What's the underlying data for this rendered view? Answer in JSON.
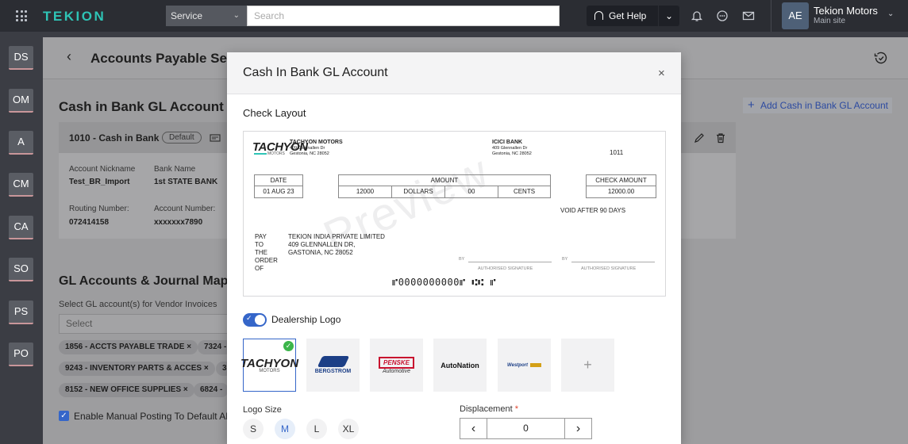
{
  "topbar": {
    "brand": "TEKION",
    "service_select": "Service",
    "search_placeholder": "Search",
    "help_label": "Get Help",
    "account": {
      "initials": "AE",
      "name": "Tekion Motors",
      "site": "Main site"
    }
  },
  "sidebar": {
    "items": [
      "DS",
      "OM",
      "A",
      "CM",
      "CA",
      "SO",
      "PS",
      "PO"
    ]
  },
  "page": {
    "title": "Accounts Payable Setti",
    "section_title": "Cash in Bank GL Account",
    "add_link": "Add Cash in Bank GL Account",
    "card": {
      "title": "1010 - Cash in Bank",
      "badge": "Default",
      "fields": {
        "nickname_label": "Account Nickname",
        "nickname_value": "Test_BR_Import",
        "bank_label": "Bank Name",
        "bank_value": "1st STATE BANK",
        "routing_label": "Routing Number:",
        "routing_value": "072414158",
        "account_label": "Account Number:",
        "account_value": "xxxxxxx7890"
      }
    },
    "gl_title": "GL Accounts & Journal Mapp",
    "gl_subtitle": "Select GL account(s) for Vendor Invoices",
    "gl_select_placeholder": "Select",
    "chips": [
      "1856 - ACCTS PAYABLE TRADE",
      "7324 -",
      "9243 - INVENTORY PARTS & ACCES",
      "3",
      "8152 - NEW OFFICE SUPPLIES",
      "6824 -"
    ],
    "checkbox_label": "Enable Manual Posting To Default AP"
  },
  "modal": {
    "title": "Cash In Bank GL Account",
    "close_glyph": "×",
    "check_layout_title": "Check Layout",
    "check": {
      "watermark": "Preview",
      "company_logo": "TACHYON",
      "company_logo_sub": "MOTORS",
      "company_name": "TACHYON MOTORS",
      "company_addr1": "409 Glennallen Dr",
      "company_addr2": "Gestonia, NC 28052",
      "bank_name": "ICICI BANK",
      "bank_addr1": "409 Glennallen Dr",
      "bank_addr2": "Gestonia, NC 28052",
      "check_number": "1011",
      "date_label": "DATE",
      "date_value": "01 AUG 23",
      "amount_label": "AMOUNT",
      "amount_dollars": "12000",
      "dollars_label": "DOLLARS",
      "amount_cents": "00",
      "cents_label": "CENTS",
      "check_amount_label": "CHECK AMOUNT",
      "check_amount_value": "12000.00",
      "void_text": "VOID AFTER 90 DAYS",
      "pay_label_1": "PAY",
      "pay_label_2": "TO",
      "pay_label_3": "THE",
      "pay_label_4": "ORDER",
      "pay_label_5": "OF",
      "payee_1": "TEKION INDIA PRIVATE LIMITED",
      "payee_2": "409 GLENNALLEN DR,",
      "payee_3": "GASTONIA, NC 28052",
      "by_label": "BY",
      "sig_label": "AUTHORISED SIGNATURE",
      "micr": "⑈0000000000⑈ ⑆⑆ ⑈"
    },
    "logo_toggle_label": "Dealership Logo",
    "logo_toggle_on": true,
    "logos": [
      "TACHYON",
      "BERGSTROM",
      "PENSKE",
      "AutoNation",
      "Westport",
      "+"
    ],
    "logo_labels": {
      "bergstrom": "BERGSTROM",
      "penske": "PENSKE",
      "penske_sub": "Automotive",
      "autonation": "AutoNation",
      "westport": "Westport"
    },
    "logo_size_label": "Logo Size",
    "sizes": [
      "S",
      "M",
      "L",
      "XL"
    ],
    "selected_size": "M",
    "displacement_label": "Displacement",
    "displacement_value": "0"
  }
}
